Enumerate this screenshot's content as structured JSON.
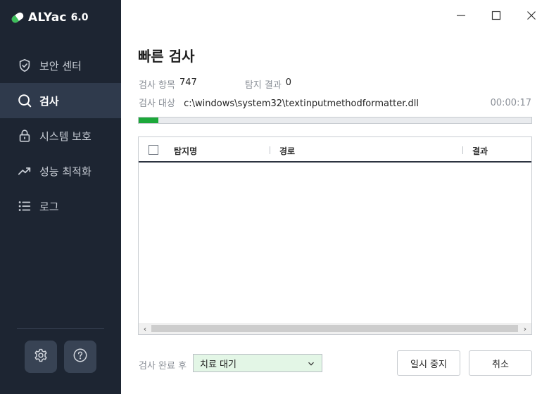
{
  "app": {
    "name": "ALYac",
    "version": "6.0"
  },
  "sidebar": {
    "items": [
      {
        "label": "보안 센터",
        "icon": "shield-icon"
      },
      {
        "label": "검사",
        "icon": "search-icon",
        "active": true
      },
      {
        "label": "시스템 보호",
        "icon": "lock-icon"
      },
      {
        "label": "성능 최적화",
        "icon": "trend-up-icon"
      },
      {
        "label": "로그",
        "icon": "list-icon"
      }
    ],
    "bottom_buttons": [
      {
        "icon": "gear-icon"
      },
      {
        "icon": "help-icon"
      }
    ]
  },
  "window": {
    "controls": [
      "minimize",
      "maximize",
      "close"
    ]
  },
  "scan": {
    "title": "빠른 검사",
    "items_label": "검사 항목",
    "items_count": "747",
    "detected_label": "탐지 결과",
    "detected_count": "0",
    "target_label": "검사 대상",
    "target_path": "c:\\windows\\system32\\textinputmethodformatter.dll",
    "elapsed": "00:00:17",
    "progress_fraction": 0.05
  },
  "table": {
    "columns": [
      "탐지명",
      "경로",
      "결과"
    ],
    "rows": []
  },
  "footer": {
    "after_scan_label": "검사 완료 후",
    "after_scan_value": "치료 대기",
    "pause_label": "일시 중지",
    "cancel_label": "취소"
  },
  "colors": {
    "sidebar_bg": "#1d2532",
    "sidebar_active": "#2f3a4c",
    "accent_green": "#1ca83a",
    "select_bg": "#e3f6e6"
  }
}
